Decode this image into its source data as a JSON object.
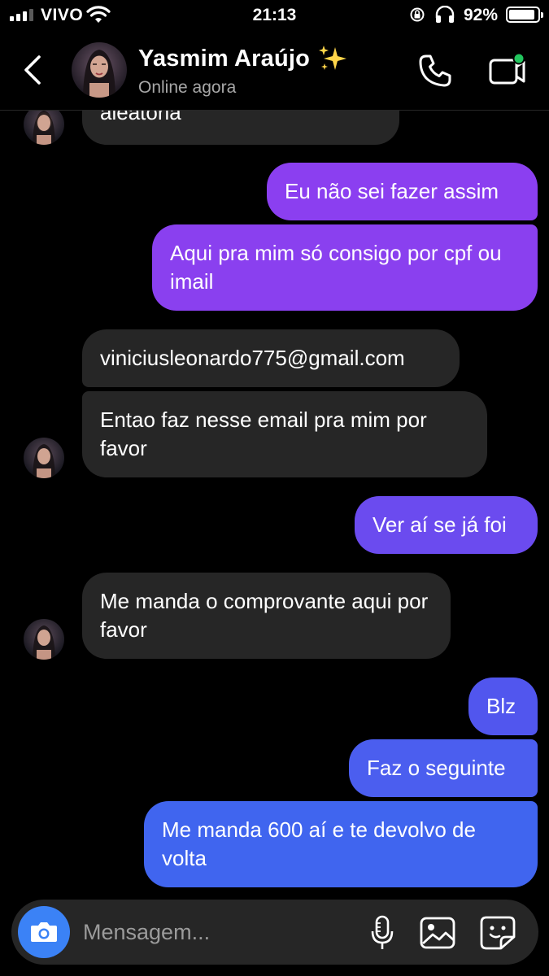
{
  "status_bar": {
    "carrier": "VIVO",
    "time": "21:13",
    "battery": "92%",
    "battery_level": 0.92,
    "signal_bars_active": 3
  },
  "header": {
    "contact_name": "Yasmim Araújo",
    "status": "Online agora",
    "back_icon": "chevron-left-icon",
    "call_icon": "phone-icon",
    "video_icon": "video-call-icon",
    "video_active_indicator_color": "#22c55e"
  },
  "messages": [
    {
      "side": "in",
      "text": "aleatoria"
    },
    {
      "side": "out",
      "text": "Eu não sei fazer assim"
    },
    {
      "side": "out",
      "text": "Aqui pra mim só consigo por cpf ou imail"
    },
    {
      "side": "in",
      "text": "viniciusleonardo775@gmail.com"
    },
    {
      "side": "in",
      "text": "Entao faz nesse email pra mim por favor"
    },
    {
      "side": "out",
      "text": "Ver aí se já foi"
    },
    {
      "side": "in",
      "text": "Me manda o comprovante aqui por favor"
    },
    {
      "side": "out",
      "text": "Blz"
    },
    {
      "side": "out",
      "text": "Faz o seguinte"
    },
    {
      "side": "out",
      "text": "Me manda 600 aí e te devolvo de volta"
    }
  ],
  "composer": {
    "placeholder": "Mensagem...",
    "camera_icon": "camera-icon",
    "mic_icon": "microphone-icon",
    "gallery_icon": "image-icon",
    "sticker_icon": "sticker-icon"
  },
  "colors": {
    "background": "#000000",
    "incoming_bubble": "#262626",
    "outgoing_gradient_top": "#8b3ff0",
    "outgoing_gradient_bottom": "#3d6cf0",
    "camera_button": "#3b82f6"
  }
}
